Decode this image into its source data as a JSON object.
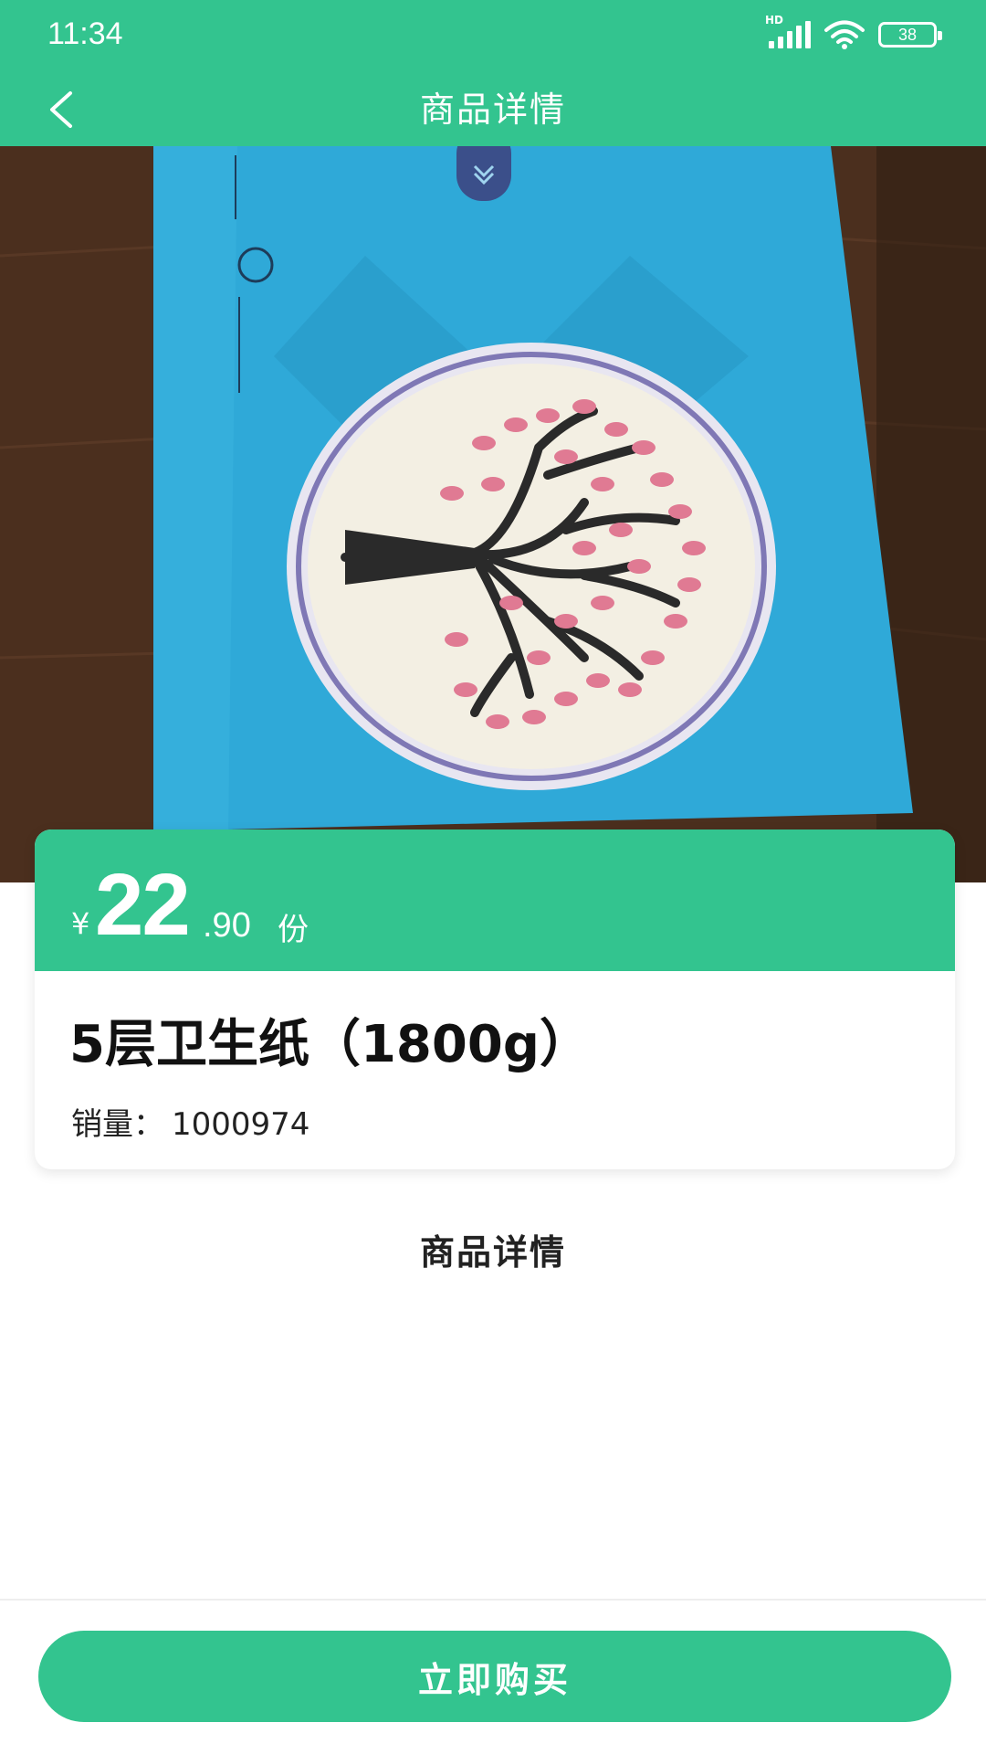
{
  "status_bar": {
    "time": "11:34",
    "hd_label": "HD",
    "battery": "38"
  },
  "nav": {
    "title": "商品详情"
  },
  "product": {
    "currency": "¥",
    "price_integer": "22",
    "price_decimal": ".90",
    "price_unit": "份",
    "name": "5层卫生纸（1800g）",
    "sales_label": "销量：",
    "sales_count": "1000974"
  },
  "details": {
    "title": "商品详情"
  },
  "actions": {
    "buy_label": "立即购买"
  },
  "colors": {
    "brand_green": "#33c48f",
    "package_blue": "#2fa9d8",
    "leaf_pink": "#e07a93"
  }
}
